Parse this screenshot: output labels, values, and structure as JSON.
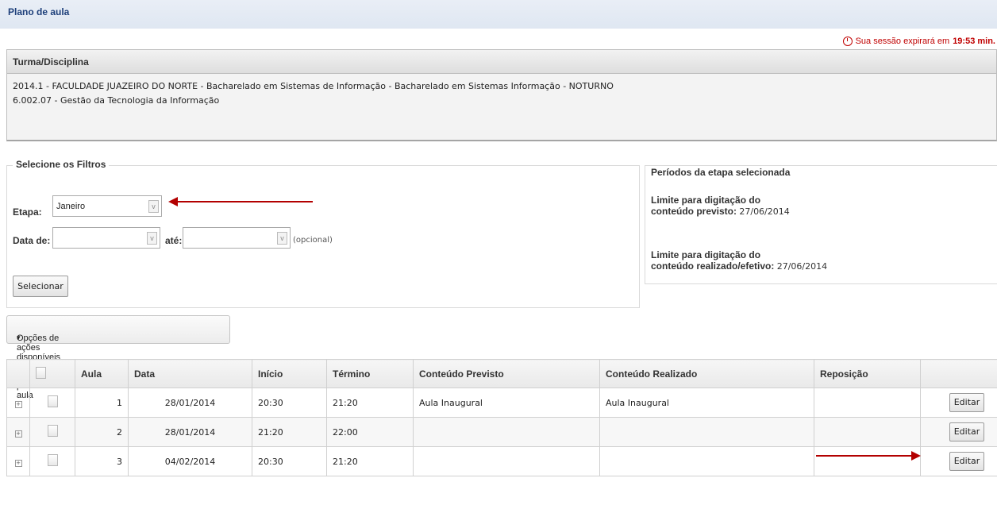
{
  "page": {
    "title": "Plano de aula"
  },
  "session": {
    "label": "Sua sessão expirará em",
    "time": "19:53 min."
  },
  "turma": {
    "heading": "Turma/Disciplina",
    "line1": "2014.1 - FACULDADE JUAZEIRO DO NORTE - Bacharelado em Sistemas de Informação - Bacharelado em Sistemas Informação - NOTURNO",
    "line2": "6.002.07 - Gestão da Tecnologia da Informação"
  },
  "filters": {
    "legend": "Selecione os Filtros",
    "etapa_label": "Etapa:",
    "etapa_value": "Janeiro",
    "data_de_label": "Data de:",
    "data_de_value": "",
    "ate_label": "até:",
    "ate_value": "",
    "optional": "(opcional)",
    "select_button": "Selecionar"
  },
  "periods": {
    "legend": "Períodos da etapa selecionada",
    "previsto_l1": "Limite para digitação do",
    "previsto_l2": "conteúdo previsto:",
    "previsto_date": "27/06/2014",
    "realizado_l1": "Limite para digitação do",
    "realizado_l2": "conteúdo realizado/efetivo:",
    "realizado_date": "27/06/2014"
  },
  "actions": {
    "label": "Opções de ações disponíveis para as aulas do plano de aula",
    "caret": "▾"
  },
  "table": {
    "headers": [
      "Aula",
      "Data",
      "Início",
      "Término",
      "Conteúdo Previsto",
      "Conteúdo Realizado",
      "Reposição"
    ],
    "rows": [
      {
        "aula": "1",
        "data": "28/01/2014",
        "inicio": "20:30",
        "termino": "21:20",
        "previsto": "Aula Inaugural",
        "realizado": "Aula Inaugural",
        "reposicao": "",
        "button": "Editar"
      },
      {
        "aula": "2",
        "data": "28/01/2014",
        "inicio": "21:20",
        "termino": "22:00",
        "previsto": "",
        "realizado": "",
        "reposicao": "",
        "button": "Editar"
      },
      {
        "aula": "3",
        "data": "04/02/2014",
        "inicio": "20:30",
        "termino": "21:20",
        "previsto": "",
        "realizado": "",
        "reposicao": "",
        "button": "Editar"
      }
    ]
  },
  "icons": {
    "expand": "expand-icon",
    "clock": "clock-icon",
    "select_arrow": "chevron-down-icon"
  },
  "colors": {
    "accent_red": "#b30000",
    "title_blue": "#1d3f7a"
  }
}
